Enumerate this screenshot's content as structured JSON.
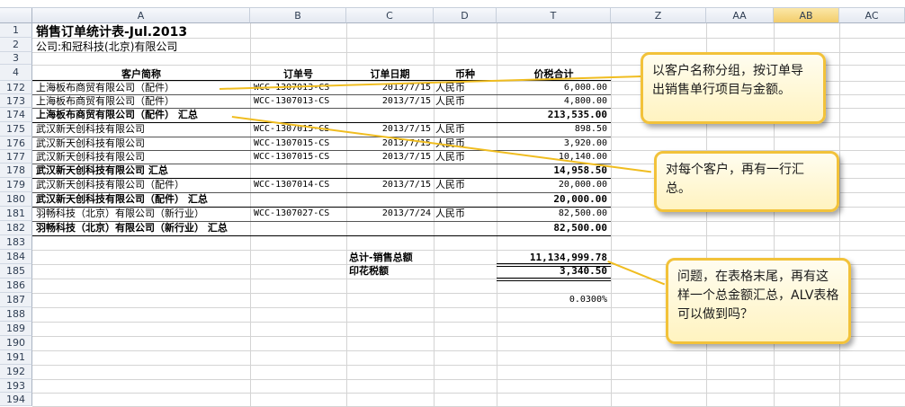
{
  "columns": [
    "A",
    "B",
    "C",
    "D",
    "T",
    "Z",
    "AA",
    "AB",
    "AC"
  ],
  "selected_column": "AB",
  "row_numbers": [
    "1",
    "2",
    "3",
    "4",
    "172",
    "173",
    "174",
    "175",
    "176",
    "177",
    "178",
    "179",
    "180",
    "181",
    "182",
    "183",
    "184",
    "185",
    "186",
    "187",
    "188",
    "189",
    "190",
    "191",
    "192",
    "193",
    "194"
  ],
  "title": "销售订单统计表-Jul.2013",
  "company": "公司:和冠科技(北京)有限公司",
  "headers": {
    "customer": "客户简称",
    "order_no": "订单号",
    "order_date": "订单日期",
    "currency": "币种",
    "amount": "价税合计"
  },
  "rows": [
    {
      "customer": "上海板布商贸有限公司（配件）",
      "order_no": "WCC-1307013-CS",
      "date": "2013/7/15",
      "currency": "人民币",
      "amount": "6,000.00"
    },
    {
      "customer": "上海板布商贸有限公司（配件）",
      "order_no": "WCC-1307013-CS",
      "date": "2013/7/15",
      "currency": "人民币",
      "amount": "4,800.00"
    },
    {
      "customer": "上海板布商贸有限公司（配件） 汇总",
      "subtotal": true,
      "amount": "213,535.00"
    },
    {
      "customer": "武汉新天创科技有限公司",
      "order_no": "WCC-1307015-CS",
      "date": "2013/7/15",
      "currency": "人民币",
      "amount": "898.50"
    },
    {
      "customer": "武汉新天创科技有限公司",
      "order_no": "WCC-1307015-CS",
      "date": "2013/7/15",
      "currency": "人民币",
      "amount": "3,920.00"
    },
    {
      "customer": "武汉新天创科技有限公司",
      "order_no": "WCC-1307015-CS",
      "date": "2013/7/15",
      "currency": "人民币",
      "amount": "10,140.00"
    },
    {
      "customer": "武汉新天创科技有限公司 汇总",
      "subtotal": true,
      "amount": "14,958.50"
    },
    {
      "customer": "武汉新天创科技有限公司（配件）",
      "order_no": "WCC-1307014-CS",
      "date": "2013/7/15",
      "currency": "人民币",
      "amount": "20,000.00"
    },
    {
      "customer": "武汉新天创科技有限公司（配件） 汇总",
      "subtotal": true,
      "amount": "20,000.00"
    },
    {
      "customer": "羽畅科技（北京）有限公司（新行业）",
      "order_no": "WCC-1307027-CS",
      "date": "2013/7/24",
      "currency": "人民币",
      "amount": "82,500.00"
    },
    {
      "customer": "羽畅科技（北京）有限公司（新行业） 汇总",
      "subtotal": true,
      "amount": "82,500.00"
    }
  ],
  "totals": {
    "grand_label": "总计-销售总额",
    "grand_value": "11,134,999.78",
    "stamp_label": "印花税额",
    "stamp_value": "3,340.50",
    "rate": "0.0300%"
  },
  "callouts": [
    "以客户名称分组，按订单导出销售单行项目与金额。",
    "对每个客户，再有一行汇总。",
    "问题，在表格末尾，再有这样一个总金额汇总，ALV表格可以做到吗？"
  ],
  "colors": {
    "callout_border": "#f2c23a",
    "callout_fill": "#fff6cc",
    "selected_header": "#f3cd6a"
  }
}
